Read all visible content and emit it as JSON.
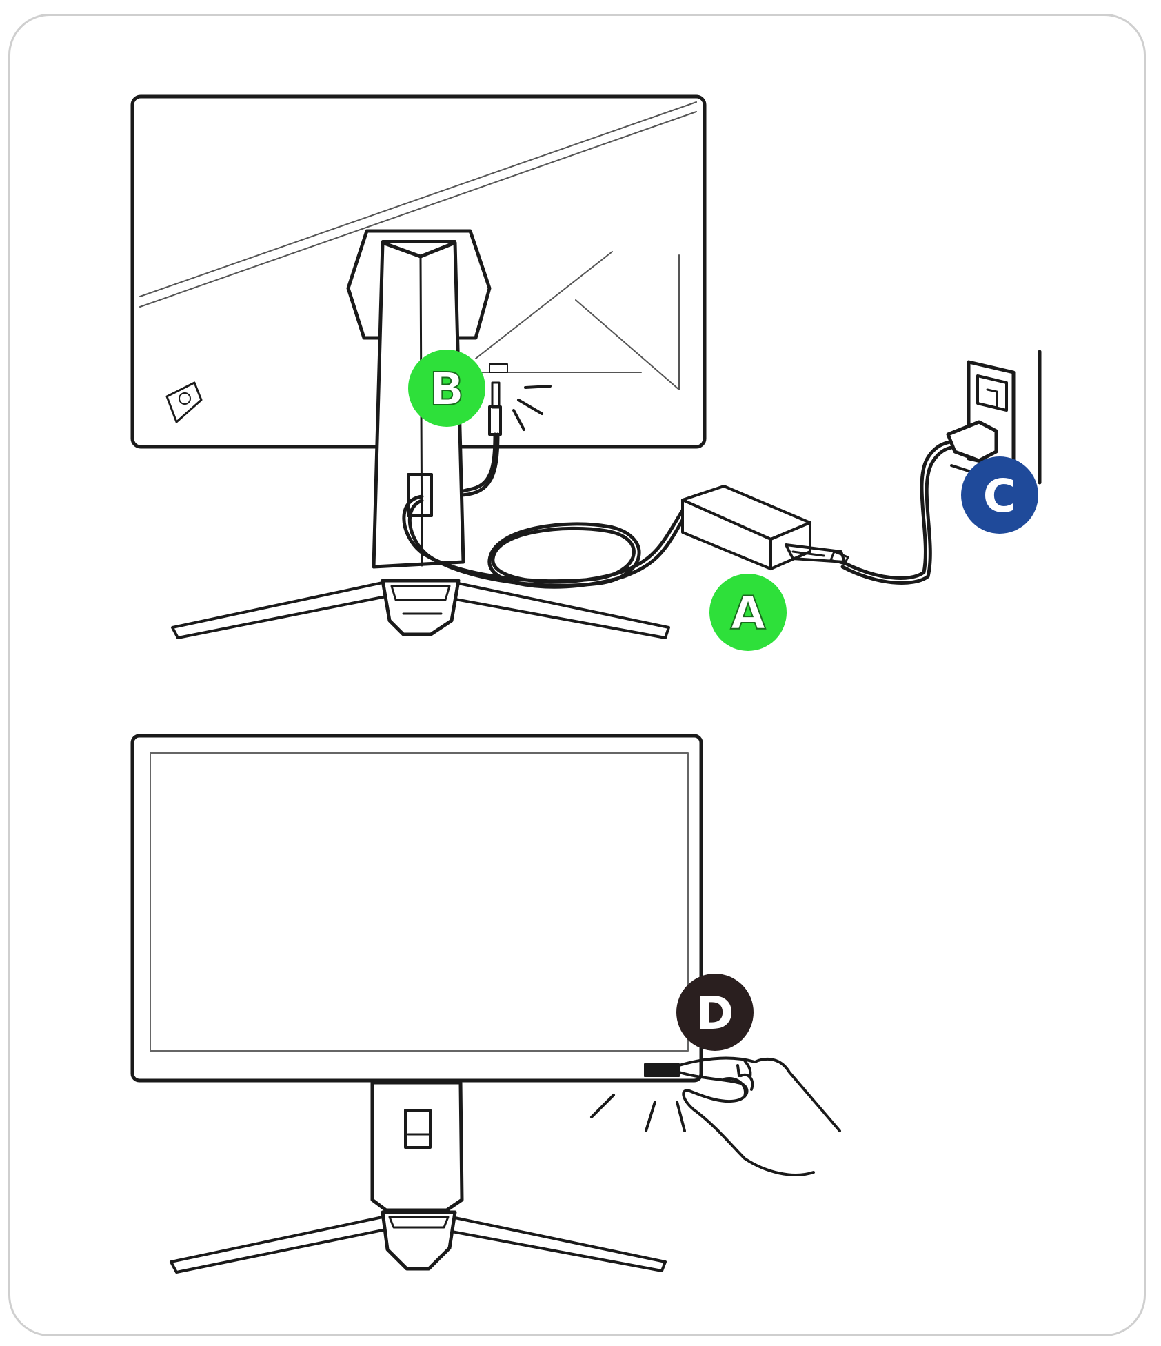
{
  "labels": {
    "a": "A",
    "b": "B",
    "c": "C",
    "d": "D"
  },
  "colors": {
    "green": "#2ee03a",
    "blue": "#1f4a9a",
    "dark": "#2a1f1f",
    "line": "#1a1a1a",
    "frame": "#cfcfcf"
  }
}
